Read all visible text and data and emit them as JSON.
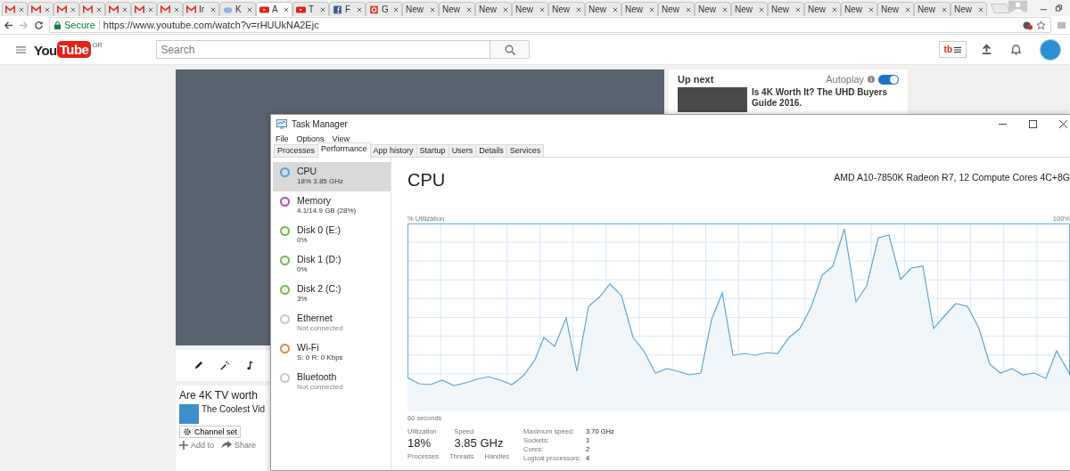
{
  "browser": {
    "tabs": [
      {
        "kind": "gmail",
        "selected": false
      },
      {
        "kind": "gmail",
        "selected": false
      },
      {
        "kind": "gmail",
        "selected": false
      },
      {
        "kind": "gmail",
        "selected": false
      },
      {
        "kind": "gmail",
        "selected": false
      },
      {
        "kind": "gmail",
        "selected": false
      },
      {
        "kind": "gmail",
        "selected": false
      },
      {
        "kind": "gmail",
        "label": "Ir",
        "selected": false
      },
      {
        "kind": "weather",
        "label": "K",
        "selected": false
      },
      {
        "kind": "youtube",
        "label": "A",
        "selected": true
      },
      {
        "kind": "youtube",
        "label": "T",
        "selected": false
      },
      {
        "kind": "facebook",
        "label": "F",
        "selected": false
      },
      {
        "kind": "google",
        "label": "G",
        "selected": false
      },
      {
        "kind": "plain",
        "label": "New",
        "selected": false
      },
      {
        "kind": "plain",
        "label": "New",
        "selected": false
      },
      {
        "kind": "plain",
        "label": "New",
        "selected": false
      },
      {
        "kind": "plain",
        "label": "New",
        "selected": false
      },
      {
        "kind": "plain",
        "label": "New",
        "selected": false
      },
      {
        "kind": "plain",
        "label": "New",
        "selected": false
      },
      {
        "kind": "plain",
        "label": "New",
        "selected": false
      },
      {
        "kind": "plain",
        "label": "New",
        "selected": false
      },
      {
        "kind": "plain",
        "label": "New",
        "selected": false
      },
      {
        "kind": "plain",
        "label": "New",
        "selected": false
      },
      {
        "kind": "plain",
        "label": "New",
        "selected": false
      },
      {
        "kind": "plain",
        "label": "New",
        "selected": false
      },
      {
        "kind": "plain",
        "label": "New",
        "selected": false
      },
      {
        "kind": "plain",
        "label": "New",
        "selected": false
      },
      {
        "kind": "plain",
        "label": "New",
        "selected": false
      },
      {
        "kind": "plain",
        "label": "New",
        "selected": false
      }
    ],
    "security": "Secure",
    "url": "https://www.youtube.com/watch?v=rHUUkNA2Ejc"
  },
  "youtube": {
    "logo_left": "You",
    "logo_right": "Tube",
    "region": "GR",
    "search": {
      "placeholder": "Search"
    },
    "extension_badge": "tb",
    "video": {
      "title": "Are 4K TV worth",
      "channel": "The Coolest Vid",
      "channel_button": "Channel set",
      "actions": [
        "Add to",
        "Share"
      ]
    },
    "up_next": {
      "heading": "Up next",
      "autoplay_label": "Autoplay",
      "autoplay": true,
      "title": "Is 4K Worth It? The UHD Buyers Guide 2016."
    }
  },
  "task_manager": {
    "title": "Task Manager",
    "menu": [
      "File",
      "Options",
      "View"
    ],
    "tabs": [
      {
        "label": "Processes",
        "selected": false
      },
      {
        "label": "Performance",
        "selected": true
      },
      {
        "label": "App history",
        "selected": false
      },
      {
        "label": "Startup",
        "selected": false
      },
      {
        "label": "Users",
        "selected": false
      },
      {
        "label": "Details",
        "selected": false
      },
      {
        "label": "Services",
        "selected": false
      }
    ],
    "resources": [
      {
        "name": "CPU",
        "detail": "18%  3.85 GHz",
        "color": "#4ba3d9",
        "selected": true
      },
      {
        "name": "Memory",
        "detail": "4.1/14.9 GB (28%)",
        "color": "#b04bbf",
        "selected": false
      },
      {
        "name": "Disk 0 (E:)",
        "detail": "0%",
        "color": "#6cbf3f",
        "selected": false
      },
      {
        "name": "Disk 1 (D:)",
        "detail": "0%",
        "color": "#6cbf3f",
        "selected": false
      },
      {
        "name": "Disk 2 (C:)",
        "detail": "3%",
        "color": "#6cbf3f",
        "selected": false
      },
      {
        "name": "Ethernet",
        "detail": "Not connected",
        "color": "#c8c8c8",
        "selected": false
      },
      {
        "name": "Wi-Fi",
        "detail": "S: 0 R: 0 Kbps",
        "color": "#d98a4b",
        "selected": false
      },
      {
        "name": "Bluetooth",
        "detail": "Not connected",
        "color": "#c8c8c8",
        "selected": false
      }
    ],
    "panel": {
      "heading": "CPU",
      "model": "AMD A10-7850K Radeon R7, 12 Compute Cores 4C+8G",
      "y_label": "% Utilization",
      "y_max": "100%",
      "x_label": "60 seconds",
      "stats": [
        {
          "label": "Utilization",
          "value": "18%"
        },
        {
          "label": "Speed",
          "value": "3.85 GHz"
        }
      ],
      "counters": [
        "Processes",
        "Threads",
        "Handles"
      ],
      "specs": [
        {
          "label": "Maximum speed:",
          "value": "3.70 GHz"
        },
        {
          "label": "Sockets:",
          "value": "1"
        },
        {
          "label": "Cores:",
          "value": "2"
        },
        {
          "label": "Logical processors:",
          "value": "4"
        }
      ]
    }
  }
}
